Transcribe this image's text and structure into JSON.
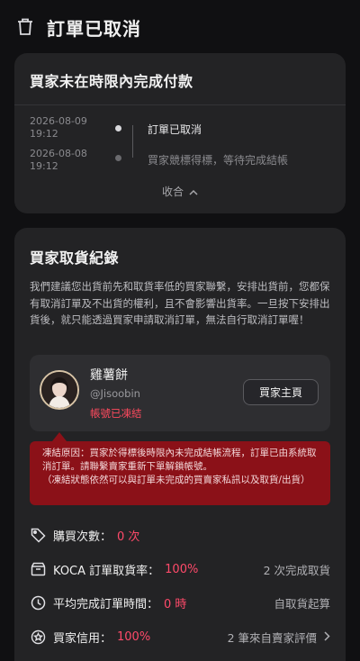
{
  "header": {
    "title": "訂單已取消",
    "icon": "trash-icon"
  },
  "status_card": {
    "title": "買家未在時限內完成付款",
    "timeline": [
      {
        "date": "2026-08-09",
        "time": "19:12",
        "text": "訂單已取消",
        "color": "#e8e8ea"
      },
      {
        "date": "2026-08-08",
        "time": "19:12",
        "text": "買家競標得標，等待完成結帳",
        "color": "#8a8a8e"
      }
    ],
    "collapse_label": "收合"
  },
  "buyer_card": {
    "title": "買家取貨紀錄",
    "description": "我們建議您出貨前先和取貨率低的買家聯繫，安排出貨前，您都保有取消訂單及不出貨的權利，且不會影響出貨率。一旦按下安排出貨後，就只能透過買家申請取消訂單，無法自行取消訂單喔！",
    "buyer": {
      "name": "雞薯餅",
      "handle": "@Jisoobin",
      "status": "帳號已凍結",
      "home_button": "買家主頁"
    },
    "freeze_notice": "凍結原因：買家於得標後時限內未完成結帳流程，訂單已由系統取消訂單。請聯繫賣家重新下單解鎖帳號。\n（凍結狀態依然可以與訂單未完成的買賣家私訊以及取貨/出貨）",
    "stats": [
      {
        "icon": "tag-icon",
        "label": "購買次數：",
        "value": "0 次",
        "right": ""
      },
      {
        "icon": "box-icon",
        "label": "KOCA 訂單取貨率：",
        "value": "100%",
        "right": "2 次完成取貨"
      },
      {
        "icon": "clock-icon",
        "label": "平均完成訂單時間：",
        "value": "0 時",
        "right": "自取貨起算"
      },
      {
        "icon": "star-badge-icon",
        "label": "買家信用：",
        "value": "100%",
        "right": "2 筆來自賣家評價"
      }
    ]
  },
  "colors": {
    "accent": "#ff4a6a",
    "danger_bg": "#8b1118",
    "card_bg": "#232325"
  }
}
